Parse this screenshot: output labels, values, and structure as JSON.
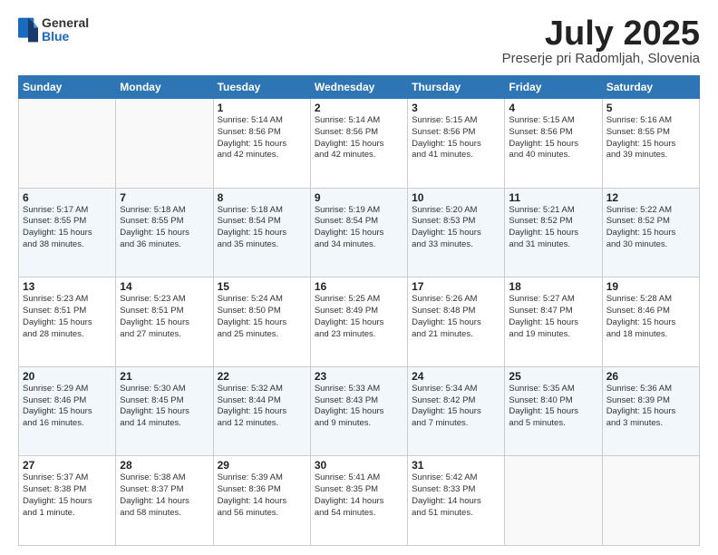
{
  "header": {
    "logo_general": "General",
    "logo_blue": "Blue",
    "month_title": "July 2025",
    "location": "Preserje pri Radomljah, Slovenia"
  },
  "weekdays": [
    "Sunday",
    "Monday",
    "Tuesday",
    "Wednesday",
    "Thursday",
    "Friday",
    "Saturday"
  ],
  "weeks": [
    [
      {
        "day": "",
        "info": ""
      },
      {
        "day": "",
        "info": ""
      },
      {
        "day": "1",
        "info": "Sunrise: 5:14 AM\nSunset: 8:56 PM\nDaylight: 15 hours\nand 42 minutes."
      },
      {
        "day": "2",
        "info": "Sunrise: 5:14 AM\nSunset: 8:56 PM\nDaylight: 15 hours\nand 42 minutes."
      },
      {
        "day": "3",
        "info": "Sunrise: 5:15 AM\nSunset: 8:56 PM\nDaylight: 15 hours\nand 41 minutes."
      },
      {
        "day": "4",
        "info": "Sunrise: 5:15 AM\nSunset: 8:56 PM\nDaylight: 15 hours\nand 40 minutes."
      },
      {
        "day": "5",
        "info": "Sunrise: 5:16 AM\nSunset: 8:55 PM\nDaylight: 15 hours\nand 39 minutes."
      }
    ],
    [
      {
        "day": "6",
        "info": "Sunrise: 5:17 AM\nSunset: 8:55 PM\nDaylight: 15 hours\nand 38 minutes."
      },
      {
        "day": "7",
        "info": "Sunrise: 5:18 AM\nSunset: 8:55 PM\nDaylight: 15 hours\nand 36 minutes."
      },
      {
        "day": "8",
        "info": "Sunrise: 5:18 AM\nSunset: 8:54 PM\nDaylight: 15 hours\nand 35 minutes."
      },
      {
        "day": "9",
        "info": "Sunrise: 5:19 AM\nSunset: 8:54 PM\nDaylight: 15 hours\nand 34 minutes."
      },
      {
        "day": "10",
        "info": "Sunrise: 5:20 AM\nSunset: 8:53 PM\nDaylight: 15 hours\nand 33 minutes."
      },
      {
        "day": "11",
        "info": "Sunrise: 5:21 AM\nSunset: 8:52 PM\nDaylight: 15 hours\nand 31 minutes."
      },
      {
        "day": "12",
        "info": "Sunrise: 5:22 AM\nSunset: 8:52 PM\nDaylight: 15 hours\nand 30 minutes."
      }
    ],
    [
      {
        "day": "13",
        "info": "Sunrise: 5:23 AM\nSunset: 8:51 PM\nDaylight: 15 hours\nand 28 minutes."
      },
      {
        "day": "14",
        "info": "Sunrise: 5:23 AM\nSunset: 8:51 PM\nDaylight: 15 hours\nand 27 minutes."
      },
      {
        "day": "15",
        "info": "Sunrise: 5:24 AM\nSunset: 8:50 PM\nDaylight: 15 hours\nand 25 minutes."
      },
      {
        "day": "16",
        "info": "Sunrise: 5:25 AM\nSunset: 8:49 PM\nDaylight: 15 hours\nand 23 minutes."
      },
      {
        "day": "17",
        "info": "Sunrise: 5:26 AM\nSunset: 8:48 PM\nDaylight: 15 hours\nand 21 minutes."
      },
      {
        "day": "18",
        "info": "Sunrise: 5:27 AM\nSunset: 8:47 PM\nDaylight: 15 hours\nand 19 minutes."
      },
      {
        "day": "19",
        "info": "Sunrise: 5:28 AM\nSunset: 8:46 PM\nDaylight: 15 hours\nand 18 minutes."
      }
    ],
    [
      {
        "day": "20",
        "info": "Sunrise: 5:29 AM\nSunset: 8:46 PM\nDaylight: 15 hours\nand 16 minutes."
      },
      {
        "day": "21",
        "info": "Sunrise: 5:30 AM\nSunset: 8:45 PM\nDaylight: 15 hours\nand 14 minutes."
      },
      {
        "day": "22",
        "info": "Sunrise: 5:32 AM\nSunset: 8:44 PM\nDaylight: 15 hours\nand 12 minutes."
      },
      {
        "day": "23",
        "info": "Sunrise: 5:33 AM\nSunset: 8:43 PM\nDaylight: 15 hours\nand 9 minutes."
      },
      {
        "day": "24",
        "info": "Sunrise: 5:34 AM\nSunset: 8:42 PM\nDaylight: 15 hours\nand 7 minutes."
      },
      {
        "day": "25",
        "info": "Sunrise: 5:35 AM\nSunset: 8:40 PM\nDaylight: 15 hours\nand 5 minutes."
      },
      {
        "day": "26",
        "info": "Sunrise: 5:36 AM\nSunset: 8:39 PM\nDaylight: 15 hours\nand 3 minutes."
      }
    ],
    [
      {
        "day": "27",
        "info": "Sunrise: 5:37 AM\nSunset: 8:38 PM\nDaylight: 15 hours\nand 1 minute."
      },
      {
        "day": "28",
        "info": "Sunrise: 5:38 AM\nSunset: 8:37 PM\nDaylight: 14 hours\nand 58 minutes."
      },
      {
        "day": "29",
        "info": "Sunrise: 5:39 AM\nSunset: 8:36 PM\nDaylight: 14 hours\nand 56 minutes."
      },
      {
        "day": "30",
        "info": "Sunrise: 5:41 AM\nSunset: 8:35 PM\nDaylight: 14 hours\nand 54 minutes."
      },
      {
        "day": "31",
        "info": "Sunrise: 5:42 AM\nSunset: 8:33 PM\nDaylight: 14 hours\nand 51 minutes."
      },
      {
        "day": "",
        "info": ""
      },
      {
        "day": "",
        "info": ""
      }
    ]
  ]
}
